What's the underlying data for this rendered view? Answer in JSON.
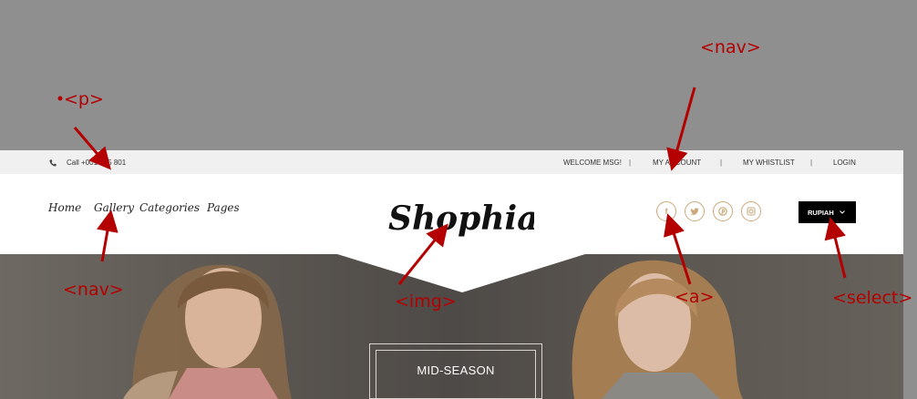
{
  "topbar": {
    "phone_text": "Call +001 555 801",
    "links": [
      "WELCOME MSG!",
      "MY ACCOUNT",
      "MY WHISTLIST",
      "LOGIN"
    ],
    "separator": "|"
  },
  "header": {
    "nav_items": [
      "Home",
      "Gallery",
      "Categories",
      "Pages"
    ],
    "logo_text": "Shophia",
    "social_icons": [
      "facebook-icon",
      "twitter-icon",
      "pinterest-icon",
      "instagram-icon"
    ],
    "currency_label": "RUPIAH"
  },
  "hero": {
    "promo_text": "MID-SEASON"
  },
  "annotations": {
    "p": "<p>",
    "nav_top": "<nav>",
    "nav_left": "<nav>",
    "img": "<img>",
    "a": "<a>",
    "select": "<select>"
  },
  "colors": {
    "background": "#8f8f8f",
    "annotation": "#b40000",
    "social_accent": "#c9a97a",
    "currency_bg": "#000000"
  }
}
